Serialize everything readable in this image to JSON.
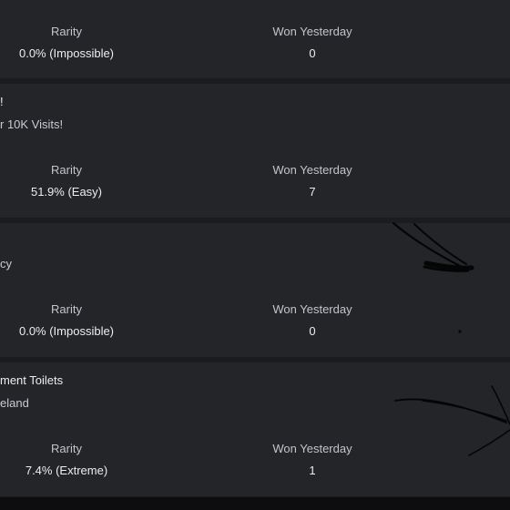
{
  "badges": [
    {
      "title": "",
      "description": "",
      "rarity_label": "Rarity",
      "rarity_value": "0.0% (Impossible)",
      "won_label": "Won Yesterday",
      "won_value": "0"
    },
    {
      "title": "!",
      "description": "r 10K Visits!",
      "rarity_label": "Rarity",
      "rarity_value": "51.9% (Easy)",
      "won_label": "Won Yesterday",
      "won_value": "7"
    },
    {
      "title": "",
      "description": "cy",
      "rarity_label": "Rarity",
      "rarity_value": "0.0% (Impossible)",
      "won_label": "Won Yesterday",
      "won_value": "0"
    },
    {
      "title": "ment Toilets",
      "description": "eland",
      "rarity_label": "Rarity",
      "rarity_value": "7.4% (Extreme)",
      "won_label": "Won Yesterday",
      "won_value": "1"
    }
  ]
}
